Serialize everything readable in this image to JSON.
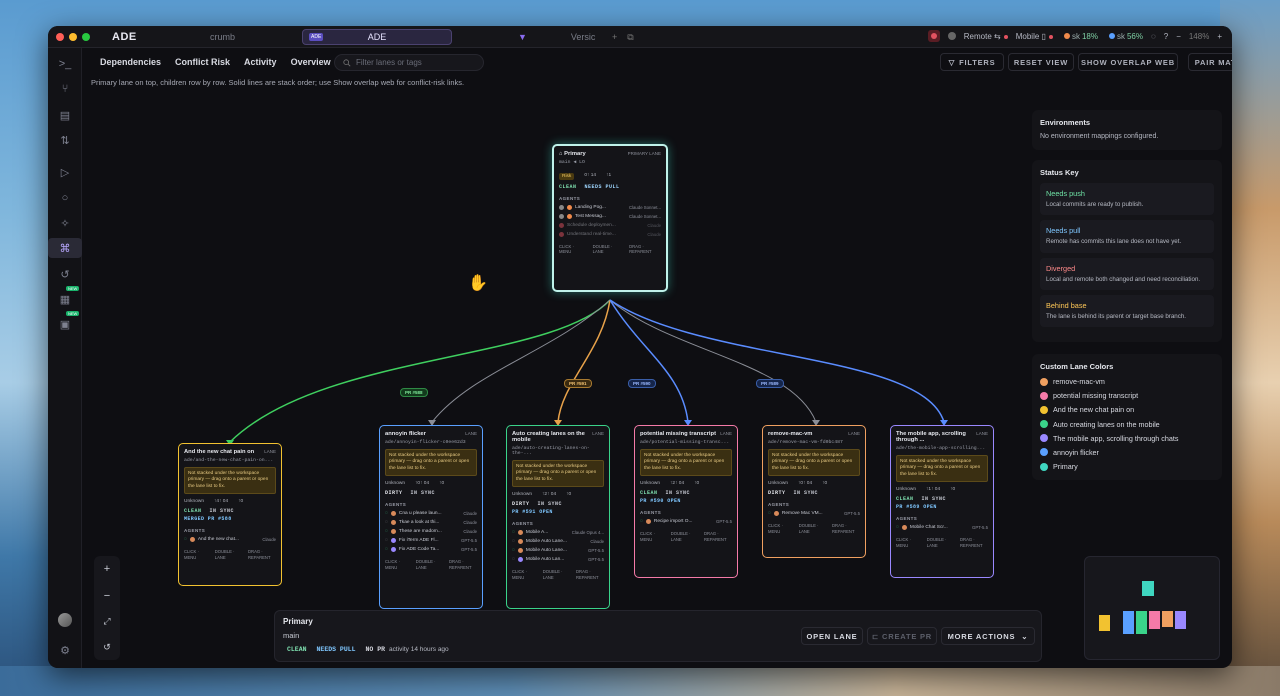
{
  "app": {
    "brand": "ADE",
    "crumb": "crumb",
    "active_tab": "ADE",
    "tab_badge": "ADE",
    "tab2": "Versic",
    "remote": "Remote",
    "mobile": "Mobile",
    "stat1": "18%",
    "stat2": "56%",
    "stat_prefix1": "sk",
    "stat_prefix2": "sk",
    "zoom": "148%"
  },
  "toolbar": {
    "tabs": [
      "Dependencies",
      "Conflict Risk",
      "Activity",
      "Overview"
    ],
    "filter_placeholder": "Filter lanes or tags",
    "filters": "FILTERS",
    "reset": "RESET VIEW",
    "overlap": "SHOW OVERLAP WEB",
    "pair": "PAIR MATRIX"
  },
  "subtitle": "Primary lane on top, children row by row. Solid lines are stack order; use Show overlap web for conflict-risk links.",
  "primary": {
    "title": "Primary",
    "badge": "PRIMARY LANE",
    "branch": "main",
    "branch_suffix": "LO",
    "risk": "Risk",
    "stats": "0↑ 14",
    "stats2": "↑1",
    "chip1": "CLEAN",
    "chip2": "NEEDS PULL",
    "agents_h": "AGENTS",
    "agents": [
      {
        "name": "Landing Pog...",
        "model": "Claude Sonnet..."
      },
      {
        "name": "Test Messag...",
        "model": "Claude Sonnet..."
      },
      {
        "name": "Schedule deploymen...",
        "model": "Claude"
      },
      {
        "name": "Understand real-time...",
        "model": "Claude"
      }
    ],
    "foot": [
      "CLICK · MENU",
      "DOUBLE · LANE",
      "DRAG · REPARENT"
    ]
  },
  "edge_labels": [
    "PR #588",
    "PR #591",
    "PR #590",
    "PR #589"
  ],
  "lanes": [
    {
      "title": "And the new chat pain on",
      "path": "ade/and-the-new-chat-pain-on...",
      "warn": "Not stacked under the workspace primary — drag onto a parent or open the lane list to fix.",
      "unk": "Unknown",
      "s1": "↑4↑ 04",
      "s2": "↑0",
      "c1": "CLEAN",
      "c2": "IN SYNC",
      "pr": "MERGED PR #588",
      "agents": [
        {
          "name": "And the new chat...",
          "model": "Claude"
        }
      ]
    },
    {
      "title": "annoyin flicker",
      "path": "ade/annoyin-flicker-c0ee62d3",
      "warn": "Not stacked under the workspace primary — drag onto a parent or open the lane list to fix.",
      "unk": "Unknown",
      "s1": "↑0↑ 04",
      "s2": "↑0",
      "c1": "DIRTY",
      "c2": "IN SYNC",
      "pr": "",
      "agents": [
        {
          "name": "Cna u please laun...",
          "model": "Claude"
        },
        {
          "name": "Tkae a look at thi...",
          "model": "Claude"
        },
        {
          "name": "These are madom...",
          "model": "Claude"
        },
        {
          "name": "Fix iTerm ADE Fl...",
          "model": "GPT-5.5"
        },
        {
          "name": "Fix ADE Code Ta...",
          "model": "GPT-5.5"
        }
      ]
    },
    {
      "title": "Auto creating lanes on the mobile",
      "path": "ade/auto-creating-lanes-on-the-...",
      "warn": "Not stacked under the workspace primary — drag onto a parent or open the lane list to fix.",
      "unk": "Unknown",
      "s1": "↑2↑ 04",
      "s2": "↑0",
      "c1": "DIRTY",
      "c2": "IN SYNC",
      "pr": "PR #591 OPEN",
      "agents": [
        {
          "name": "Mobile A...",
          "model": "Claude Opus 4..."
        },
        {
          "name": "Mobile Auto Lane...",
          "model": "Claude"
        },
        {
          "name": "Mobile Auto Lane...",
          "model": "GPT-5.5"
        },
        {
          "name": "Mobile Auto Lan...",
          "model": "GPT-5.5"
        }
      ]
    },
    {
      "title": "potential missing transcript",
      "path": "ade/potential-missing-transc...",
      "warn": "Not stacked under the workspace primary — drag onto a parent or open the lane list to fix.",
      "unk": "Unknown",
      "s1": "↑2↑ 04",
      "s2": "↑0",
      "c1": "CLEAN",
      "c2": "IN SYNC",
      "pr": "PR #590 OPEN",
      "agents": [
        {
          "name": "Recipe import O...",
          "model": "GPT-5.5"
        }
      ]
    },
    {
      "title": "remove-mac-vm",
      "path": "ade/remove-mac-vm-fd0bc487",
      "warn": "Not stacked under the workspace primary — drag onto a parent or open the lane list to fix.",
      "unk": "Unknown",
      "s1": "↑0↑ 04",
      "s2": "↑0",
      "c1": "DIRTY",
      "c2": "IN SYNC",
      "pr": "",
      "agents": [
        {
          "name": "Remove Mac VM...",
          "model": "GPT-5.5"
        }
      ]
    },
    {
      "title": "The mobile app, scrolling through ...",
      "path": "ade/the-mobile-app-scrolling...",
      "warn": "Not stacked under the workspace primary — drag onto a parent or open the lane list to fix.",
      "unk": "Unknown",
      "s1": "↑1↑ 04",
      "s2": "↑0",
      "c1": "CLEAN",
      "c2": "IN SYNC",
      "pr": "PR #589 OPEN",
      "agents": [
        {
          "name": "Mobile Chat Scr...",
          "model": "GPT-5.5"
        }
      ]
    }
  ],
  "lane_badge": "LANE",
  "agents_label": "AGENTS",
  "foot": [
    "CLICK · MENU",
    "DOUBLE · LANE",
    "DRAG · REPARENT"
  ],
  "env": {
    "title": "Environments",
    "text": "No environment mappings configured."
  },
  "status_key": {
    "title": "Status Key",
    "items": [
      {
        "name": "Needs push",
        "desc": "Local commits are ready to publish.",
        "color": "#6fe3a6"
      },
      {
        "name": "Needs pull",
        "desc": "Remote has commits this lane does not have yet.",
        "color": "#7fc7ff"
      },
      {
        "name": "Diverged",
        "desc": "Local and remote both changed and need reconciliation.",
        "color": "#ff8a8a"
      },
      {
        "name": "Behind base",
        "desc": "The lane is behind its parent or target base branch.",
        "color": "#ffc857"
      }
    ]
  },
  "colors": {
    "title": "Custom Lane Colors",
    "items": [
      {
        "name": "remove-mac-vm",
        "color": "#f0a060"
      },
      {
        "name": "potential missing transcript",
        "color": "#f57aa8"
      },
      {
        "name": "And the new chat pain on",
        "color": "#f2c230"
      },
      {
        "name": "Auto creating lanes on the mobile",
        "color": "#3ad38a"
      },
      {
        "name": "The mobile app, scrolling through chats",
        "color": "#9a88ff"
      },
      {
        "name": "annoyin flicker",
        "color": "#5aa0ff"
      },
      {
        "name": "Primary",
        "color": "#3fd6c0"
      }
    ]
  },
  "bottom": {
    "title": "Primary",
    "branch": "main",
    "chip1": "CLEAN",
    "chip2": "NEEDS PULL",
    "chip3": "NO PR",
    "activity": "activity 14 hours ago",
    "open": "OPEN LANE",
    "create": "CREATE PR",
    "more": "MORE ACTIONS"
  }
}
